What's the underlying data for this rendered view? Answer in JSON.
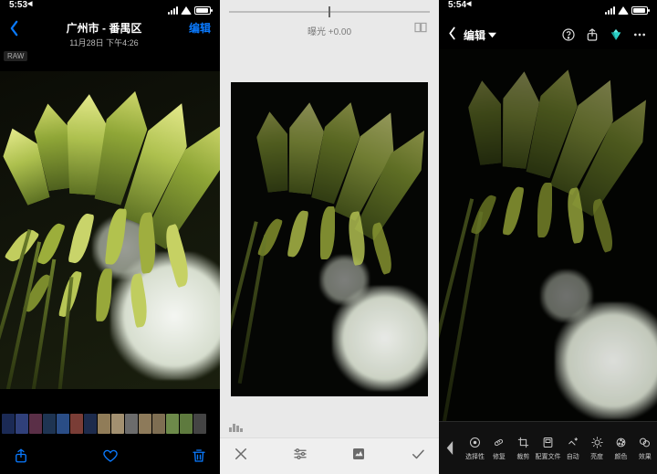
{
  "left": {
    "time": "5:53",
    "time_suffix": "◀",
    "location": "广州市 - 番禺区",
    "datetime": "11月28日 下午4:26",
    "edit_label": "编辑",
    "raw_badge": "RAW",
    "accent": "#0a7aff"
  },
  "mid": {
    "param_label": "曝光 +0.00"
  },
  "right": {
    "time": "5:54",
    "time_suffix": "◀",
    "title": "编辑",
    "tools": [
      {
        "id": "selective",
        "label": "选择性"
      },
      {
        "id": "heal",
        "label": "修复"
      },
      {
        "id": "crop",
        "label": "裁剪"
      },
      {
        "id": "preset",
        "label": "配置文件"
      },
      {
        "id": "auto",
        "label": "自动"
      },
      {
        "id": "light",
        "label": "亮度"
      },
      {
        "id": "color",
        "label": "颜色"
      },
      {
        "id": "effects",
        "label": "效果"
      }
    ]
  }
}
